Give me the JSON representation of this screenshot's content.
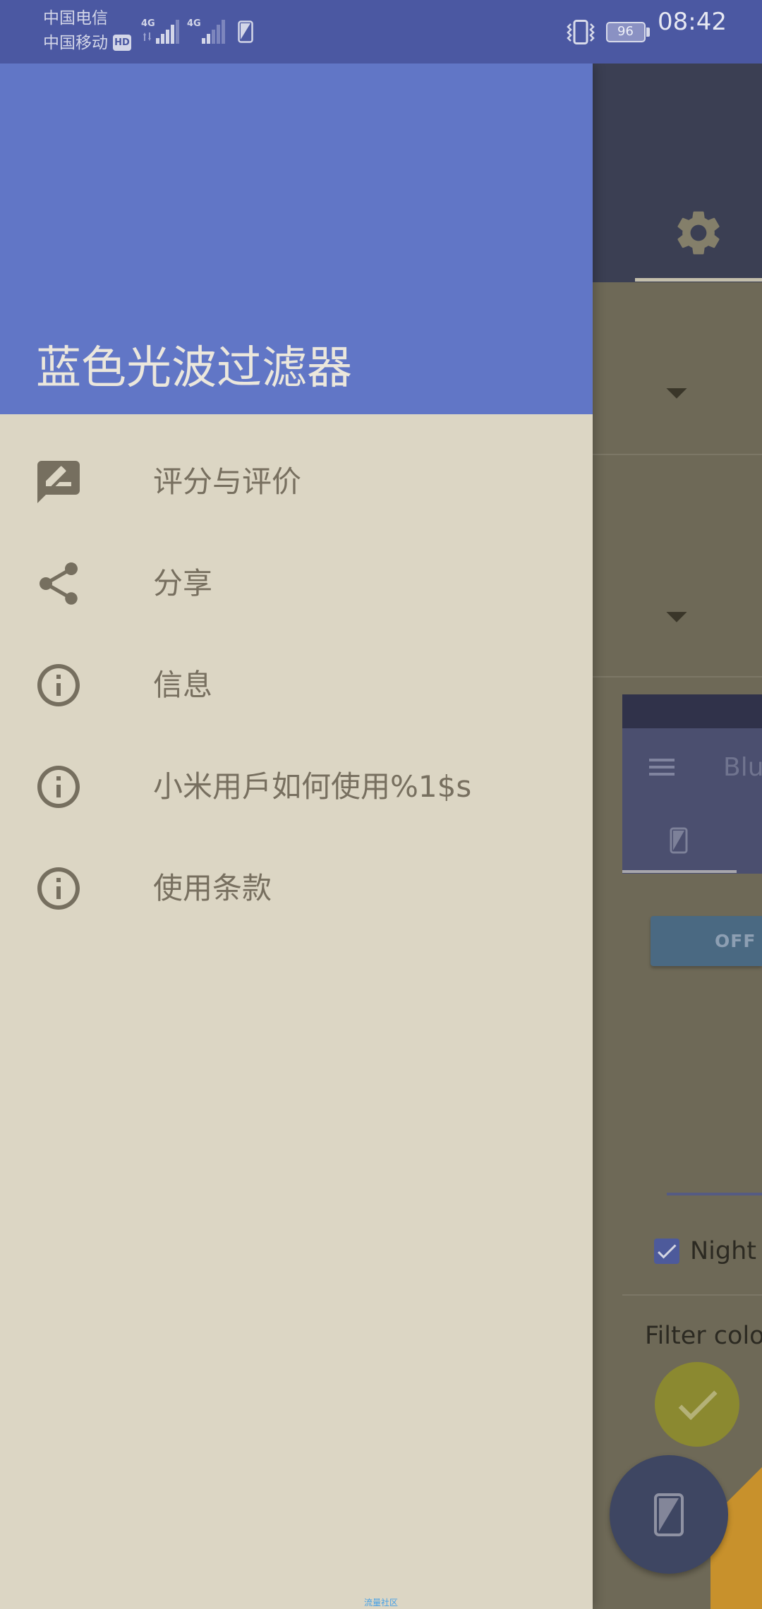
{
  "status_bar": {
    "carrier_primary": "中国电信",
    "carrier_secondary": "中国移动",
    "hd_badge": "HD",
    "network_type_1": "4G",
    "network_type_2": "4G",
    "battery_level": "96",
    "time": "08:42",
    "icons": [
      "signal-icon",
      "signal-icon",
      "sim-filter-icon",
      "vibrate-icon",
      "battery-icon"
    ]
  },
  "drawer": {
    "title": "蓝色光波过滤器",
    "items": [
      {
        "label": "评分与评价",
        "icon": "rate-review-icon"
      },
      {
        "label": "分享",
        "icon": "share-icon"
      },
      {
        "label": "信息",
        "icon": "info-icon"
      },
      {
        "label": "小米用戶如何使用%1$s",
        "icon": "info-icon"
      },
      {
        "label": "使用条款",
        "icon": "info-icon"
      }
    ]
  },
  "background_app": {
    "toolbar_tab_icon": "gear-icon",
    "dropdown_icon": "arrow-drop-down-icon",
    "preview": {
      "title": "Blu",
      "menu_icon": "menu-icon",
      "tab_icon": "phone-filter-icon"
    },
    "power_button_label": "OFF",
    "night_mode": {
      "label": "Night m",
      "checked": true
    },
    "filter_color_label": "Filter color",
    "selected_color_icon": "check-icon",
    "fab_icon": "phone-filter-icon"
  },
  "watermark": "流量社区",
  "colors": {
    "status_bar": "#4b58a2",
    "drawer_header": "#6176c6",
    "drawer_body": "#dcd6c4",
    "drawer_title": "#ebe7dc",
    "drawer_item_text": "#776f5f",
    "drawer_icon": "#766f5f",
    "app_toolbar": "#3b3f53",
    "app_body": "#6e6957",
    "accent_olive": "#8b8930",
    "fab": "#3e4662",
    "orange": "#c8912c",
    "watermark": "#45a0e6"
  }
}
